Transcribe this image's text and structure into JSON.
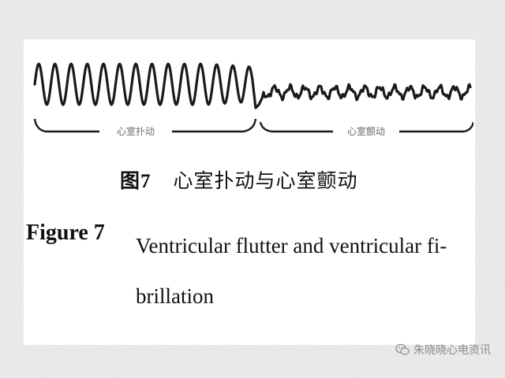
{
  "figure": {
    "segment_labels": [
      "心室扑动",
      "心室颤动"
    ],
    "caption_cn_number": "图7",
    "caption_cn_text": "心室扑动与心室颤动",
    "caption_en_label": "Figure 7",
    "caption_en_line1": "Ventricular flutter and ventricular fi-",
    "caption_en_line2": "brillation"
  },
  "watermark": {
    "text": "朱晓晓心电资讯",
    "icon": "wechat-icon"
  },
  "colors": {
    "trace": "#1a1a1a",
    "background": "#e7e7e9",
    "panel": "#ffffff"
  }
}
